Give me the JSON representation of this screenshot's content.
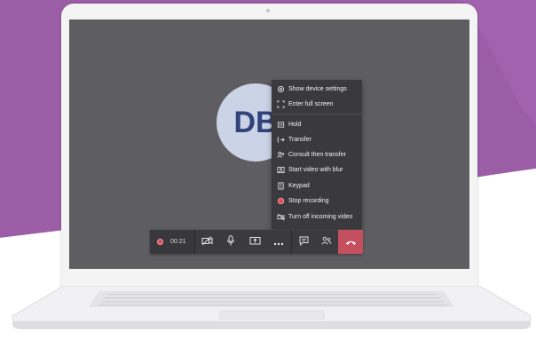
{
  "colors": {
    "purple_background": "#9b5da6",
    "screen_background": "#5e5e62",
    "menu_background": "#3a3a3e",
    "avatar_background": "#cbd3e7",
    "avatar_text": "#32427a",
    "hangup": "#c4505f",
    "recording_dot": "#e34a55"
  },
  "call": {
    "avatar_initials": "DB",
    "timer": "00:21"
  },
  "more_menu": {
    "items": [
      {
        "label": "Show device settings",
        "icon": "gear-icon"
      },
      {
        "label": "Enter full screen",
        "icon": "fullscreen-icon"
      },
      {
        "label": "Hold",
        "icon": "hold-icon"
      },
      {
        "label": "Transfer",
        "icon": "transfer-icon"
      },
      {
        "label": "Consult then transfer",
        "icon": "consult-transfer-icon"
      },
      {
        "label": "Start video with blur",
        "icon": "blur-video-icon"
      },
      {
        "label": "Keypad",
        "icon": "keypad-icon"
      },
      {
        "label": "Stop recording",
        "icon": "stop-recording-icon"
      },
      {
        "label": "Turn off incoming video",
        "icon": "video-off-icon"
      }
    ]
  },
  "toolbar": {
    "buttons": [
      {
        "name": "camera-off",
        "icon": "video-off-icon"
      },
      {
        "name": "microphone",
        "icon": "microphone-icon"
      },
      {
        "name": "share-screen",
        "icon": "share-screen-icon"
      },
      {
        "name": "more-actions",
        "icon": "ellipsis-icon"
      },
      {
        "name": "chat",
        "icon": "chat-icon"
      },
      {
        "name": "participants",
        "icon": "people-icon"
      },
      {
        "name": "hang-up",
        "icon": "hang-up-icon"
      }
    ]
  }
}
